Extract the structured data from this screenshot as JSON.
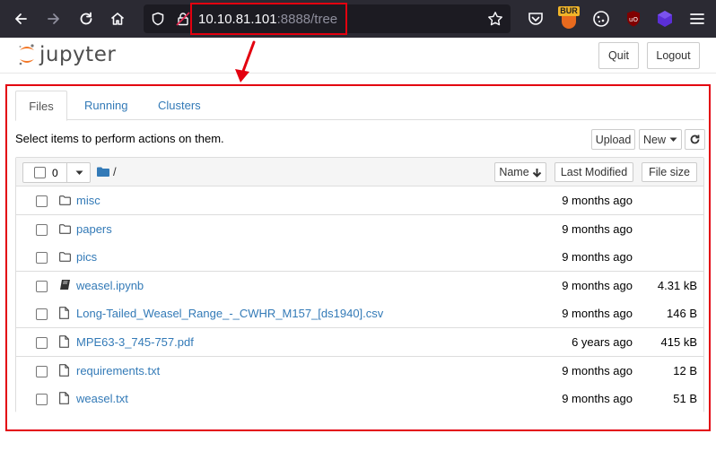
{
  "browser": {
    "url_host": "10.10.81.101",
    "url_rest": ":8888/tree",
    "ext_badge": "BUR"
  },
  "header": {
    "logo_text": "jupyter",
    "quit_label": "Quit",
    "logout_label": "Logout"
  },
  "tabs": [
    {
      "label": "Files",
      "active": true
    },
    {
      "label": "Running",
      "active": false
    },
    {
      "label": "Clusters",
      "active": false
    }
  ],
  "instructions": "Select items to perform actions on them.",
  "actions": {
    "upload_label": "Upload",
    "new_label": "New"
  },
  "list_header": {
    "selected_count": "0",
    "path": "/",
    "sort_name_label": "Name",
    "last_modified_label": "Last Modified",
    "file_size_label": "File size"
  },
  "items": [
    {
      "name": "misc",
      "type": "folder",
      "modified": "9 months ago",
      "size": ""
    },
    {
      "name": "papers",
      "type": "folder",
      "modified": "9 months ago",
      "size": ""
    },
    {
      "name": "pics",
      "type": "folder",
      "modified": "9 months ago",
      "size": ""
    },
    {
      "name": "weasel.ipynb",
      "type": "notebook",
      "modified": "9 months ago",
      "size": "4.31 kB"
    },
    {
      "name": "Long-Tailed_Weasel_Range_-_CWHR_M157_[ds1940].csv",
      "type": "file",
      "modified": "9 months ago",
      "size": "146 B"
    },
    {
      "name": "MPE63-3_745-757.pdf",
      "type": "file",
      "modified": "6 years ago",
      "size": "415 kB"
    },
    {
      "name": "requirements.txt",
      "type": "file",
      "modified": "9 months ago",
      "size": "12 B"
    },
    {
      "name": "weasel.txt",
      "type": "file",
      "modified": "9 months ago",
      "size": "51 B"
    }
  ],
  "colors": {
    "link": "#337ab7",
    "annotation": "#e3000f",
    "toolbar_bg": "#2b2a33"
  }
}
